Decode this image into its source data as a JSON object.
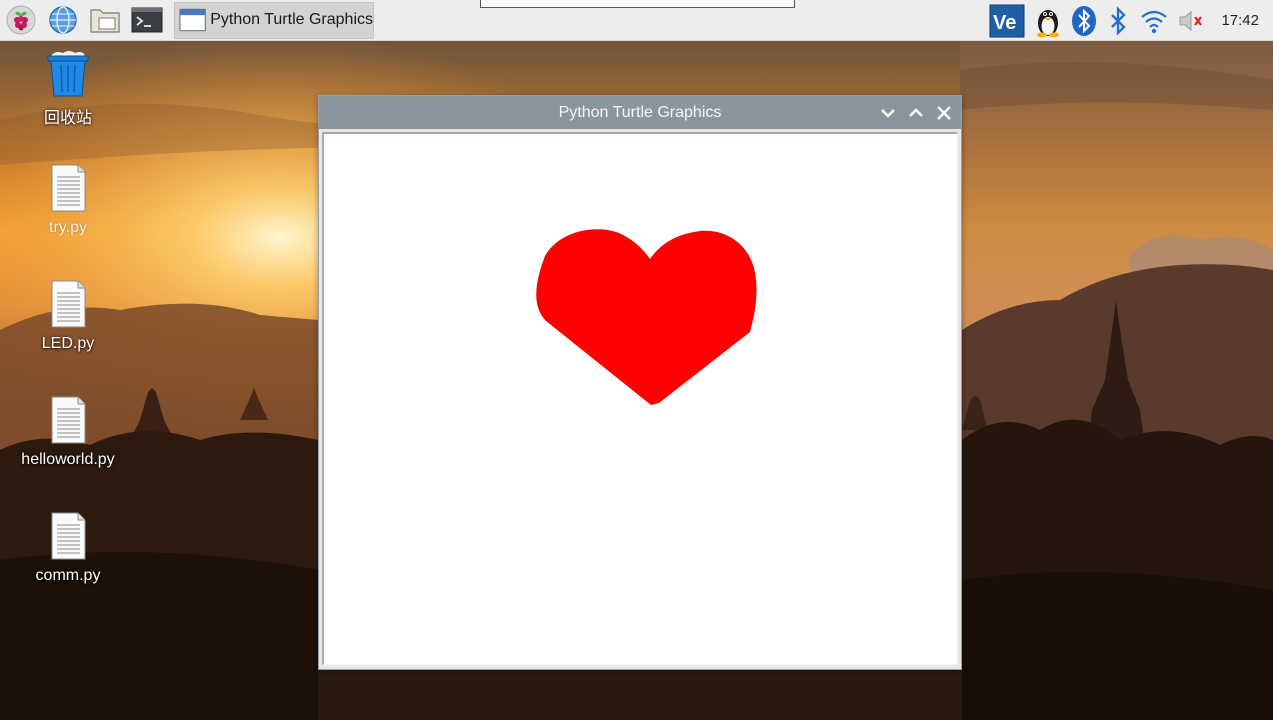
{
  "taskbar": {
    "launchers": [
      {
        "icon": "raspberry-menu-icon"
      },
      {
        "icon": "web-browser-icon"
      },
      {
        "icon": "file-manager-icon"
      },
      {
        "icon": "terminal-icon"
      }
    ],
    "active_task": {
      "icon": "window-app-icon",
      "label": "Python Turtle Graphics"
    },
    "tray": {
      "icons": [
        "vnc-icon",
        "penguin-icon",
        "bluetooth-badge-icon",
        "bluetooth-icon",
        "wifi-icon",
        "volume-muted-icon"
      ],
      "clock": "17:42"
    }
  },
  "desktop": {
    "icons": [
      {
        "label": "回收站",
        "icon": "trash-icon"
      },
      {
        "label": "try.py",
        "icon": "file-icon"
      },
      {
        "label": "LED.py",
        "icon": "file-icon"
      },
      {
        "label": "helloworld.py",
        "icon": "file-icon"
      },
      {
        "label": "comm.py",
        "icon": "file-icon"
      }
    ]
  },
  "window": {
    "title": "Python Turtle Graphics",
    "controls": [
      "minimize-icon",
      "maximize-icon",
      "close-icon"
    ],
    "drawing": {
      "shape": "heart",
      "fill_color": "#ff0000"
    }
  },
  "colors": {
    "titlebar": "#8a969d",
    "taskbar": "#ededed",
    "heart": "#ff0000"
  }
}
